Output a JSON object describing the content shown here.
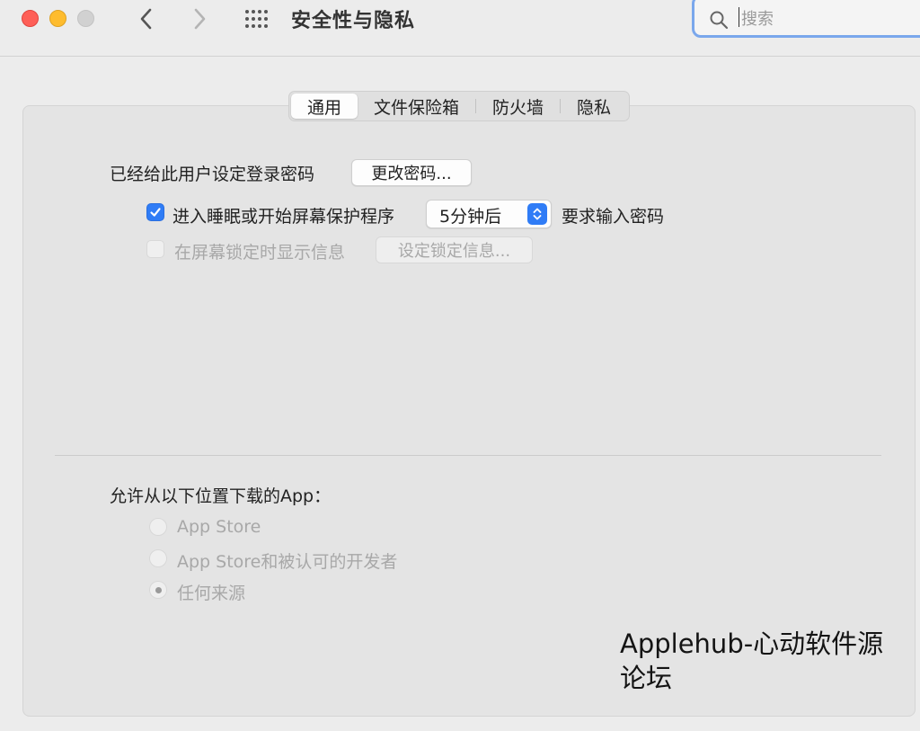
{
  "window": {
    "title": "安全性与隐私"
  },
  "search": {
    "placeholder": "搜索",
    "value": ""
  },
  "tabs": [
    {
      "label": "通用",
      "active": true
    },
    {
      "label": "文件保险箱",
      "active": false
    },
    {
      "label": "防火墙",
      "active": false
    },
    {
      "label": "隐私",
      "active": false
    }
  ],
  "general": {
    "password_label": "已经给此用户设定登录密码",
    "change_password_button": "更改密码...",
    "require_password": {
      "checked": true,
      "label_before": "进入睡眠或开始屏幕保护程序",
      "selected_delay": "5分钟后",
      "label_after": "要求输入密码"
    },
    "lock_message": {
      "checked": false,
      "enabled": false,
      "label": "在屏幕锁定时显示信息",
      "button": "设定锁定信息..."
    }
  },
  "downloads": {
    "heading": "允许从以下位置下载的App：",
    "options": [
      {
        "label": "App Store",
        "selected": false
      },
      {
        "label": "App Store和被认可的开发者",
        "selected": false
      },
      {
        "label": "任何来源",
        "selected": true
      }
    ]
  },
  "watermark": {
    "line1": "Applehub-心动软件源",
    "line2": "论坛"
  },
  "colors": {
    "accent": "#2f7cf6",
    "close": "#fe5f57",
    "minimize": "#febc2e",
    "zoom_inactive": "#d1d1d1",
    "search_focus": "#7aa7ec"
  },
  "icons": {
    "back": "chevron-left-icon",
    "forward": "chevron-right-icon",
    "show_all": "grid-icon",
    "search": "magnifier-icon",
    "select_stepper": "up-down-chevron-icon",
    "checkmark": "checkmark-icon"
  }
}
